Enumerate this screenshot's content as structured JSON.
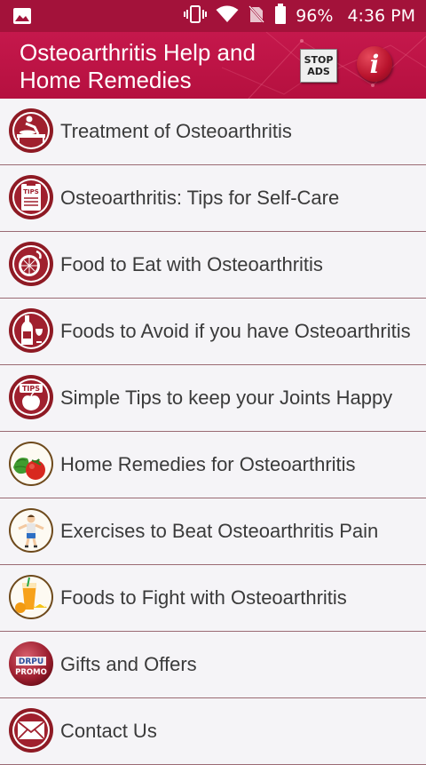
{
  "status_bar": {
    "battery": "96%",
    "time": "4:36 PM"
  },
  "app_bar": {
    "title": "Osteoarthritis Help and Home Remedies",
    "stop_ads_line1": "STOP",
    "stop_ads_line2": "ADS",
    "info_glyph": "i"
  },
  "menu": [
    {
      "label": "Treatment of Osteoarthritis",
      "icon": "massage-icon"
    },
    {
      "label": "Osteoarthritis: Tips for Self-Care",
      "icon": "tips-clipboard-icon"
    },
    {
      "label": "Food to Eat with Osteoarthritis",
      "icon": "grapefruit-icon"
    },
    {
      "label": "Foods to Avoid if you have Osteoarthritis",
      "icon": "wine-bottle-icon"
    },
    {
      "label": "Simple Tips to keep your Joints Happy",
      "icon": "tips-apple-icon"
    },
    {
      "label": "Home Remedies for Osteoarthritis",
      "icon": "vegetables-icon"
    },
    {
      "label": "Exercises to Beat Osteoarthritis Pain",
      "icon": "exercise-icon"
    },
    {
      "label": "Foods to Fight with Osteoarthritis",
      "icon": "juice-icon"
    },
    {
      "label": "Gifts and Offers",
      "icon": "drpu-promo-icon",
      "icon_text1": "DRPU",
      "icon_text2": "PROMO"
    },
    {
      "label": "Contact Us",
      "icon": "envelope-icon"
    }
  ]
}
